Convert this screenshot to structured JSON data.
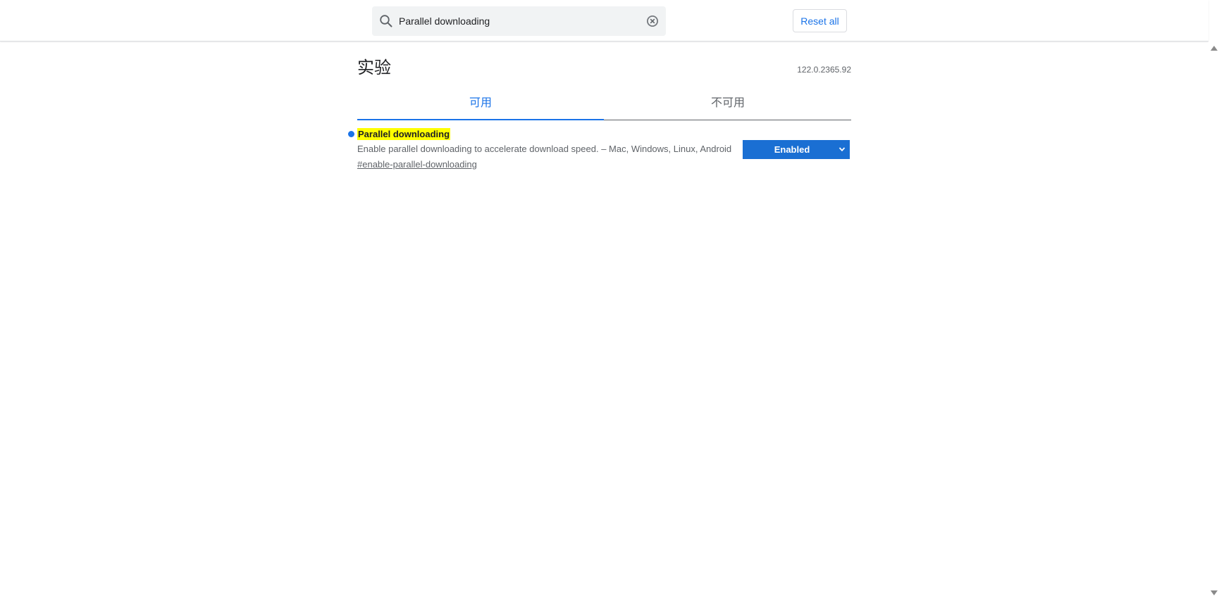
{
  "header": {
    "search": {
      "value": "Parallel downloading",
      "icon": "search-icon",
      "clear_icon": "close-circle-icon"
    },
    "reset_label": "Reset all"
  },
  "page": {
    "title": "实验",
    "version": "122.0.2365.92"
  },
  "tabs": [
    {
      "label": "可用",
      "selected": true
    },
    {
      "label": "不可用",
      "selected": false
    }
  ],
  "experiment": {
    "name": "Parallel downloading",
    "description": "Enable parallel downloading to accelerate download speed. – Mac, Windows, Linux, Android",
    "link": "#enable-parallel-downloading",
    "state": "Enabled",
    "modified_indicator_color": "#1a73e8",
    "highlight_color": "#ffff00"
  },
  "colors": {
    "accent": "#1a73e8",
    "select_bg": "#1a6fd3"
  }
}
